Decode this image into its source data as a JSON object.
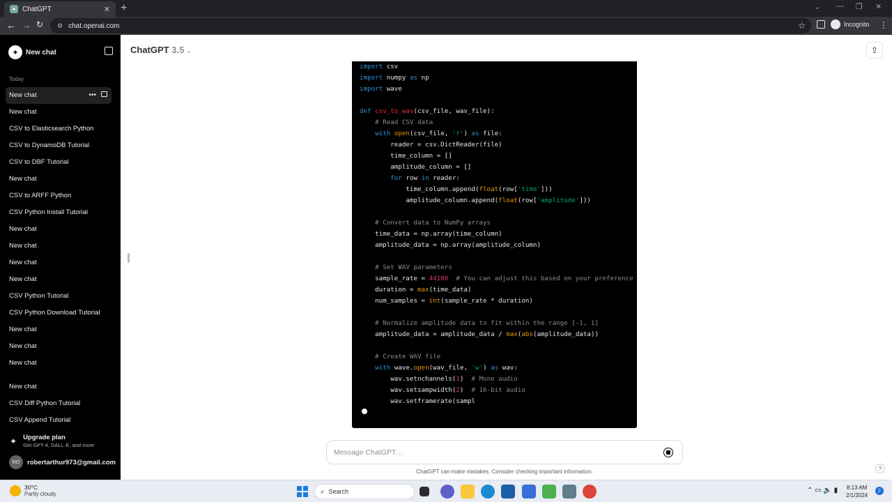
{
  "browser": {
    "tab_title": "ChatGPT",
    "url": "chat.openai.com",
    "profile_label": "Incognito"
  },
  "sidebar": {
    "new_chat_label": "New chat",
    "section_today": "Today",
    "items_today": [
      "New chat",
      "New chat",
      "CSV to Elasticsearch Python",
      "CSV to DynamoDB Tutorial",
      "CSV to DBF Tutorial",
      "New chat",
      "CSV to ARFF Python",
      "CSV Python Install Tutorial",
      "New chat",
      "New chat",
      "New chat",
      "New chat",
      "CSV Python Tutorial",
      "CSV Python Download Tutorial",
      "New chat",
      "New chat",
      "New chat"
    ],
    "items_earlier": [
      "New chat",
      "CSV Diff Python Tutorial",
      "CSV Append Tutorial"
    ],
    "upgrade_title": "Upgrade plan",
    "upgrade_subtitle": "Get GPT-4, DALL·E, and more",
    "user_initials": "RO",
    "user_email": "robertarthur973@gmail.com"
  },
  "main": {
    "model_name": "ChatGPT",
    "model_version": "3.5",
    "composer_placeholder": "Message ChatGPT…",
    "disclaimer": "ChatGPT can make mistakes. Consider checking important information.",
    "help_label": "?"
  },
  "taskbar": {
    "weather_temp": "30°C",
    "weather_desc": "Partly cloudy",
    "search_label": "Search",
    "time": "8:13 AM",
    "date": "2/1/2024",
    "notification_count": "2"
  }
}
